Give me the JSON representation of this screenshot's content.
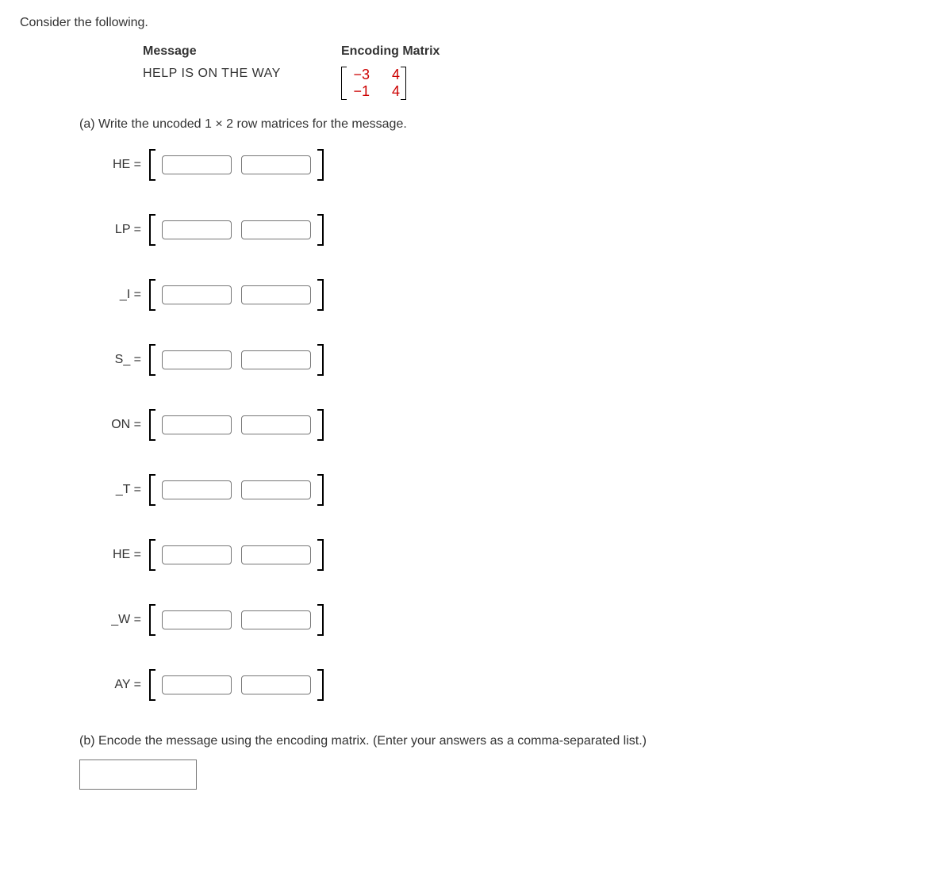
{
  "intro": "Consider the following.",
  "header": {
    "message_label": "Message",
    "encoding_label": "Encoding Matrix",
    "message_text": "HELP IS ON THE WAY",
    "matrix": {
      "r1c1": "−3",
      "r1c2": "4",
      "r2c1": "−1",
      "r2c2": "4"
    }
  },
  "partA": {
    "prompt": "(a) Write the uncoded 1 × 2 row matrices for the message.",
    "rows": [
      {
        "label": "HE ="
      },
      {
        "label": "LP ="
      },
      {
        "label": "_I ="
      },
      {
        "label": "S_ ="
      },
      {
        "label": "ON ="
      },
      {
        "label": "_T ="
      },
      {
        "label": "HE ="
      },
      {
        "label": "_W ="
      },
      {
        "label": "AY ="
      }
    ]
  },
  "partB": {
    "prompt": "(b) Encode the message using the encoding matrix. (Enter your answers as a comma-separated list.)"
  }
}
